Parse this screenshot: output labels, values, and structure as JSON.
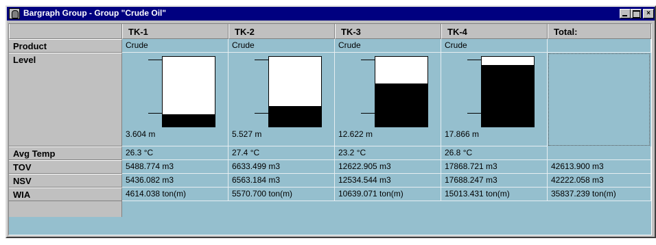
{
  "window": {
    "title": "Bargraph Group - Group \"Crude Oil\""
  },
  "columns": [
    "TK-1",
    "TK-2",
    "TK-3",
    "TK-4",
    "Total:"
  ],
  "row_labels": {
    "product": "Product",
    "level": "Level",
    "avg_temp": "Avg Temp",
    "tov": "TOV",
    "nsv": "NSV",
    "wia": "WIA"
  },
  "tanks": [
    {
      "product": "Crude",
      "level": "3.604 m",
      "fill_fraction": 0.18,
      "avg_temp": "26.3 °C",
      "tov": "5488.774 m3",
      "nsv": "5436.082 m3",
      "wia": "4614.038 ton(m)"
    },
    {
      "product": "Crude",
      "level": "5.527 m",
      "fill_fraction": 0.29,
      "avg_temp": "27.4 °C",
      "tov": "6633.499 m3",
      "nsv": "6563.184 m3",
      "wia": "5570.700 ton(m)"
    },
    {
      "product": "Crude",
      "level": "12.622 m",
      "fill_fraction": 0.62,
      "avg_temp": "23.2 °C",
      "tov": "12622.905 m3",
      "nsv": "12534.544 m3",
      "wia": "10639.071 ton(m)"
    },
    {
      "product": "Crude",
      "level": "17.866 m",
      "fill_fraction": 0.88,
      "avg_temp": "26.8 °C",
      "tov": "17868.721 m3",
      "nsv": "17688.247 m3",
      "wia": "15013.431 ton(m)"
    }
  ],
  "total": {
    "tov": "42613.900 m3",
    "nsv": "42222.058 m3",
    "wia": "35837.239 ton(m)"
  },
  "colors": {
    "grid_bg": "#95bfce",
    "header_bg": "#c0c0c0",
    "titlebar": "#000080"
  }
}
